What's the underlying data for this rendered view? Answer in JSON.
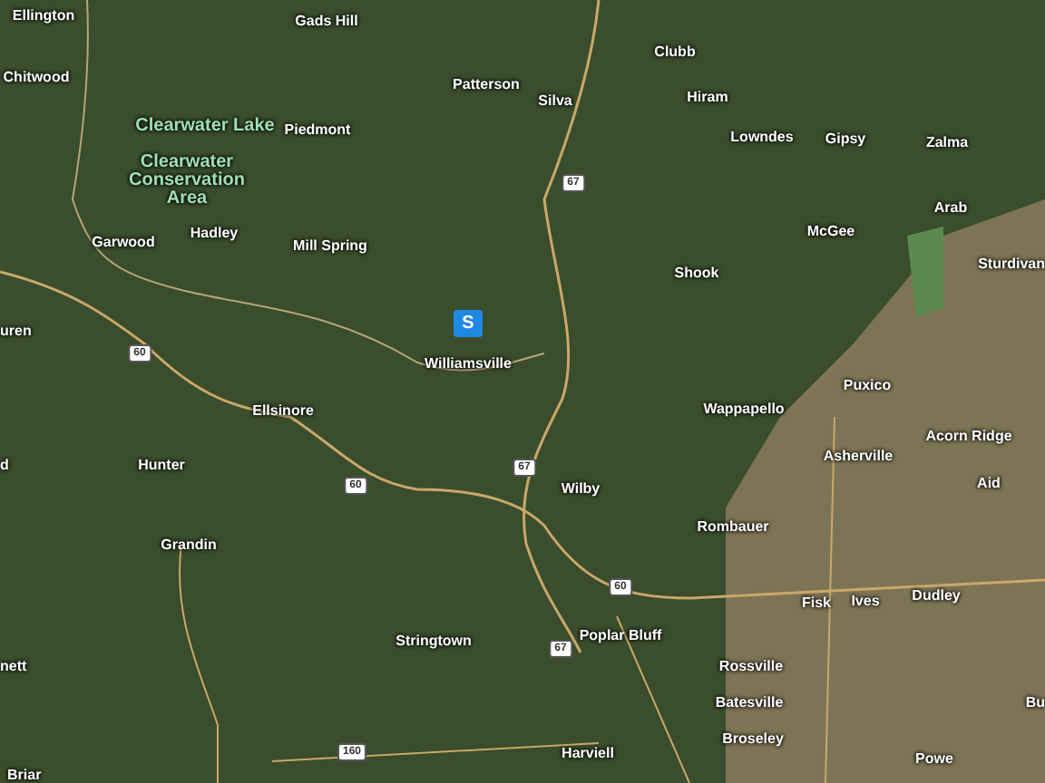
{
  "map": {
    "places": [
      {
        "name": "Ellington",
        "kind": "town"
      },
      {
        "name": "Gads Hill",
        "kind": "town"
      },
      {
        "name": "Chitwood",
        "kind": "town"
      },
      {
        "name": "Patterson",
        "kind": "town"
      },
      {
        "name": "Silva",
        "kind": "town"
      },
      {
        "name": "Clubb",
        "kind": "town"
      },
      {
        "name": "Hiram",
        "kind": "town"
      },
      {
        "name": "Lowndes",
        "kind": "town"
      },
      {
        "name": "Gipsy",
        "kind": "town"
      },
      {
        "name": "Zalma",
        "kind": "town"
      },
      {
        "name": "Arab",
        "kind": "town"
      },
      {
        "name": "McGee",
        "kind": "town"
      },
      {
        "name": "Sturdivan",
        "kind": "town"
      },
      {
        "name": "Shook",
        "kind": "town"
      },
      {
        "name": "Clearwater Lake",
        "kind": "park"
      },
      {
        "name": "Clearwater Conservation Area",
        "kind": "park"
      },
      {
        "name": "Piedmont",
        "kind": "town"
      },
      {
        "name": "Garwood",
        "kind": "town"
      },
      {
        "name": "Hadley",
        "kind": "town"
      },
      {
        "name": "Mill Spring",
        "kind": "town"
      },
      {
        "name": "Williamsville",
        "kind": "town"
      },
      {
        "name": "uren",
        "kind": "town"
      },
      {
        "name": "Ellsinore",
        "kind": "town"
      },
      {
        "name": "Puxico",
        "kind": "town"
      },
      {
        "name": "Wappapello",
        "kind": "town"
      },
      {
        "name": "Asherville",
        "kind": "town"
      },
      {
        "name": "Acorn Ridge",
        "kind": "town"
      },
      {
        "name": "Hunter",
        "kind": "town"
      },
      {
        "name": "Aid",
        "kind": "town"
      },
      {
        "name": "Wilby",
        "kind": "town"
      },
      {
        "name": "d",
        "kind": "town"
      },
      {
        "name": "Grandin",
        "kind": "town"
      },
      {
        "name": "Rombauer",
        "kind": "town"
      },
      {
        "name": "Fisk",
        "kind": "town"
      },
      {
        "name": "Ives",
        "kind": "town"
      },
      {
        "name": "Dudley",
        "kind": "town"
      },
      {
        "name": "Poplar Bluff",
        "kind": "town"
      },
      {
        "name": "Stringtown",
        "kind": "town"
      },
      {
        "name": "Rossville",
        "kind": "town"
      },
      {
        "name": "nett",
        "kind": "town"
      },
      {
        "name": "Batesville",
        "kind": "town"
      },
      {
        "name": "Broseley",
        "kind": "town"
      },
      {
        "name": "Bu",
        "kind": "town"
      },
      {
        "name": "Harviell",
        "kind": "town"
      },
      {
        "name": "Powe",
        "kind": "town"
      },
      {
        "name": "Briar",
        "kind": "town"
      }
    ],
    "route_shields": [
      "60",
      "67",
      "60",
      "67",
      "60",
      "67",
      "160"
    ],
    "marker": {
      "label": "S"
    }
  }
}
